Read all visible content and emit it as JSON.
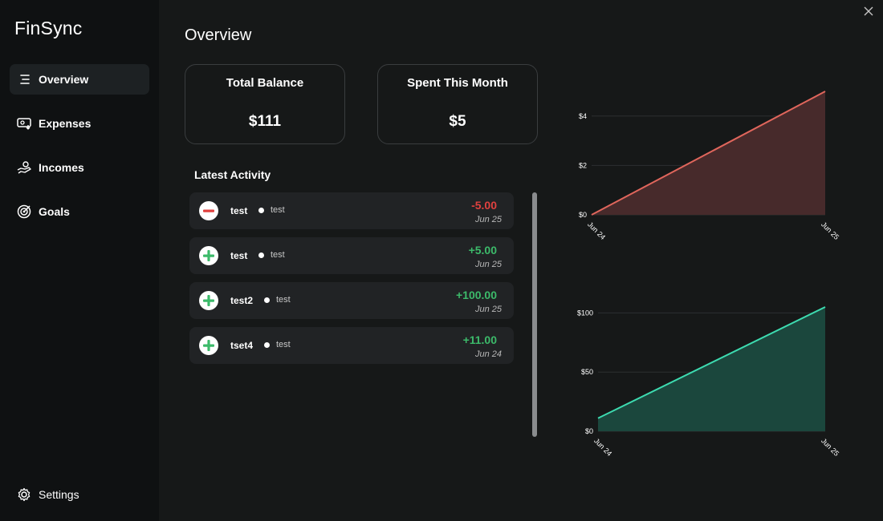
{
  "app": {
    "title": "FinSync"
  },
  "sidebar": {
    "items": [
      {
        "label": "Overview",
        "icon": "list-icon",
        "active": true
      },
      {
        "label": "Expenses",
        "icon": "wallet-icon",
        "active": false
      },
      {
        "label": "Incomes",
        "icon": "hand-coin-icon",
        "active": false
      },
      {
        "label": "Goals",
        "icon": "target-icon",
        "active": false
      }
    ],
    "settings_label": "Settings"
  },
  "page": {
    "title": "Overview"
  },
  "cards": {
    "balance": {
      "label": "Total Balance",
      "value": "$111"
    },
    "spent": {
      "label": "Spent This Month",
      "value": "$5"
    }
  },
  "activity": {
    "title": "Latest Activity",
    "rows": [
      {
        "name": "test",
        "category": "test",
        "amount": "-5.00",
        "date": "Jun 25",
        "type": "expense"
      },
      {
        "name": "test",
        "category": "test",
        "amount": "+5.00",
        "date": "Jun 25",
        "type": "income"
      },
      {
        "name": "test2",
        "category": "test",
        "amount": "+100.00",
        "date": "Jun 25",
        "type": "income"
      },
      {
        "name": "tset4",
        "category": "test",
        "amount": "+11.00",
        "date": "Jun 24",
        "type": "income"
      }
    ]
  },
  "colors": {
    "expense_line": "#e0665c",
    "expense_fill": "#472a2b",
    "income_line": "#3ddbb0",
    "income_fill": "#1b473d",
    "negative": "#e0413f",
    "positive": "#3cba6a"
  },
  "chart_data": [
    {
      "type": "area",
      "x": [
        "Jun 24",
        "Jun 25"
      ],
      "values": [
        0,
        5
      ],
      "ylim": [
        0,
        5
      ],
      "yticks": [
        0,
        2,
        4
      ],
      "ytick_labels": [
        "$0",
        "$2",
        "$4"
      ],
      "grid": true
    },
    {
      "type": "area",
      "x": [
        "Jun 24",
        "Jun 25"
      ],
      "values": [
        11,
        105
      ],
      "ylim": [
        0,
        105
      ],
      "yticks": [
        0,
        50,
        100
      ],
      "ytick_labels": [
        "$0",
        "$50",
        "$100"
      ],
      "grid": true
    }
  ]
}
